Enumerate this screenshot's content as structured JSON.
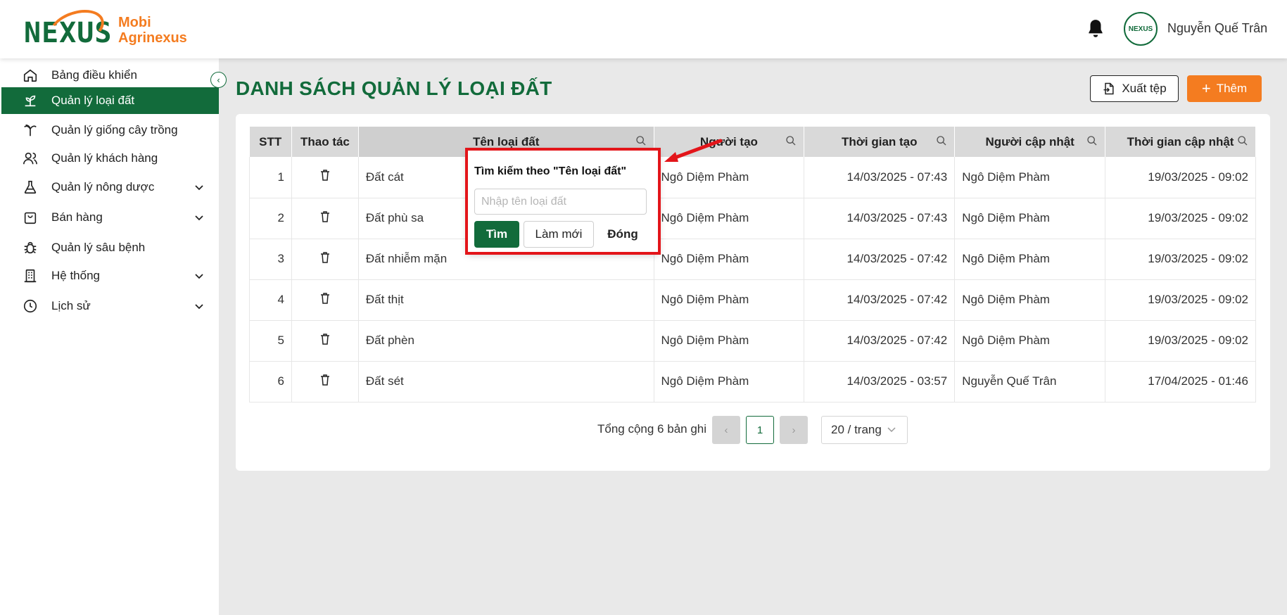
{
  "brand": {
    "line1": "Mobi",
    "line2": "Agrinexus",
    "mark": "NEXUS"
  },
  "header": {
    "username": "Nguyễn Quế Trân",
    "avatar_text": "NEXUS"
  },
  "sidebar": {
    "items": [
      {
        "label": "Bảng điều khiển",
        "icon": "home-icon"
      },
      {
        "label": "Quản lý loại đất",
        "icon": "sprout-icon",
        "active": true
      },
      {
        "label": "Quản lý giống cây trồng",
        "icon": "palm-tree-icon"
      },
      {
        "label": "Quản lý khách hàng",
        "icon": "users-icon"
      },
      {
        "label": "Quản lý nông dược",
        "icon": "flask-icon",
        "chevron": true
      },
      {
        "label": "Bán hàng",
        "icon": "shopping-bag-icon",
        "chevron": true
      },
      {
        "label": "Quản lý sâu bệnh",
        "icon": "bug-icon"
      },
      {
        "label": "Hệ thống",
        "icon": "building-icon",
        "chevron": true
      },
      {
        "label": "Lịch sử",
        "icon": "history-icon",
        "chevron": true
      }
    ]
  },
  "page": {
    "title": "DANH SÁCH QUẢN LÝ LOẠI ĐẤT",
    "export_label": "Xuất tệp",
    "add_label": "Thêm"
  },
  "table": {
    "columns": [
      "STT",
      "Thao tác",
      "Tên loại đất",
      "Người tạo",
      "Thời gian tạo",
      "Người cập nhật",
      "Thời gian cập nhật"
    ],
    "rows": [
      {
        "stt": "1",
        "name": "Đất cát",
        "creator": "Ngô Diệm Phàm",
        "created": "14/03/2025 - 07:43",
        "updater": "Ngô Diệm Phàm",
        "updated": "19/03/2025 - 09:02"
      },
      {
        "stt": "2",
        "name": "Đất phù sa",
        "creator": "Ngô Diệm Phàm",
        "created": "14/03/2025 - 07:43",
        "updater": "Ngô Diệm Phàm",
        "updated": "19/03/2025 - 09:02"
      },
      {
        "stt": "3",
        "name": "Đất nhiễm mặn",
        "creator": "Ngô Diệm Phàm",
        "created": "14/03/2025 - 07:42",
        "updater": "Ngô Diệm Phàm",
        "updated": "19/03/2025 - 09:02"
      },
      {
        "stt": "4",
        "name": "Đất thịt",
        "creator": "Ngô Diệm Phàm",
        "created": "14/03/2025 - 07:42",
        "updater": "Ngô Diệm Phàm",
        "updated": "19/03/2025 - 09:02"
      },
      {
        "stt": "5",
        "name": "Đất phèn",
        "creator": "Ngô Diệm Phàm",
        "created": "14/03/2025 - 07:42",
        "updater": "Ngô Diệm Phàm",
        "updated": "19/03/2025 - 09:02"
      },
      {
        "stt": "6",
        "name": "Đất sét",
        "creator": "Ngô Diệm Phàm",
        "created": "14/03/2025 - 03:57",
        "updater": "Nguyễn Quế Trân",
        "updated": "17/04/2025 - 01:46"
      }
    ]
  },
  "pagination": {
    "total_text": "Tổng cộng 6 bản ghi",
    "current_page": "1",
    "page_size": "20 / trang"
  },
  "search_popover": {
    "title": "Tìm kiếm theo \"Tên loại đất\"",
    "placeholder": "Nhập tên loại đất",
    "find_label": "Tìm",
    "reset_label": "Làm mới",
    "close_label": "Đóng"
  },
  "colors": {
    "brand_green": "#126b3b",
    "accent_orange": "#f47c20",
    "highlight_red": "#e3151a"
  }
}
